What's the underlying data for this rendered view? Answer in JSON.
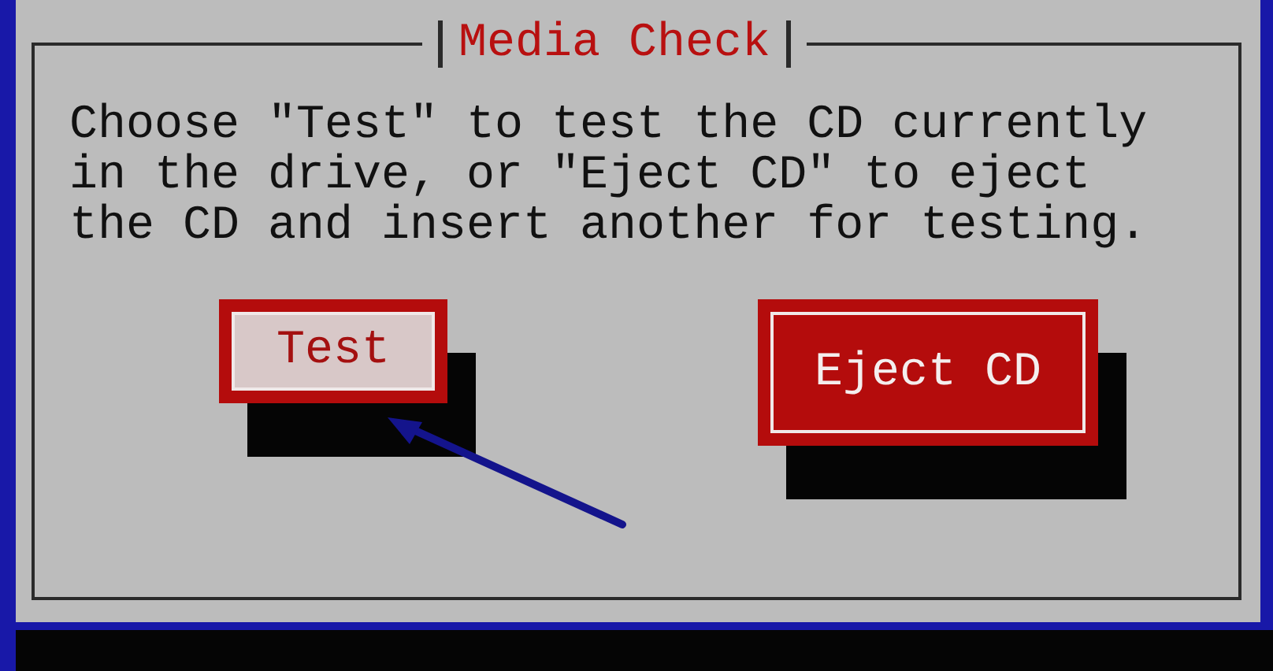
{
  "dialog": {
    "title": "Media Check",
    "message": "Choose \"Test\" to test the CD currently\nin the drive, or \"Eject CD\" to eject\nthe CD and insert another for testing.",
    "buttons": [
      {
        "label": "Test",
        "selected": true
      },
      {
        "label": "Eject CD",
        "selected": false
      }
    ]
  }
}
